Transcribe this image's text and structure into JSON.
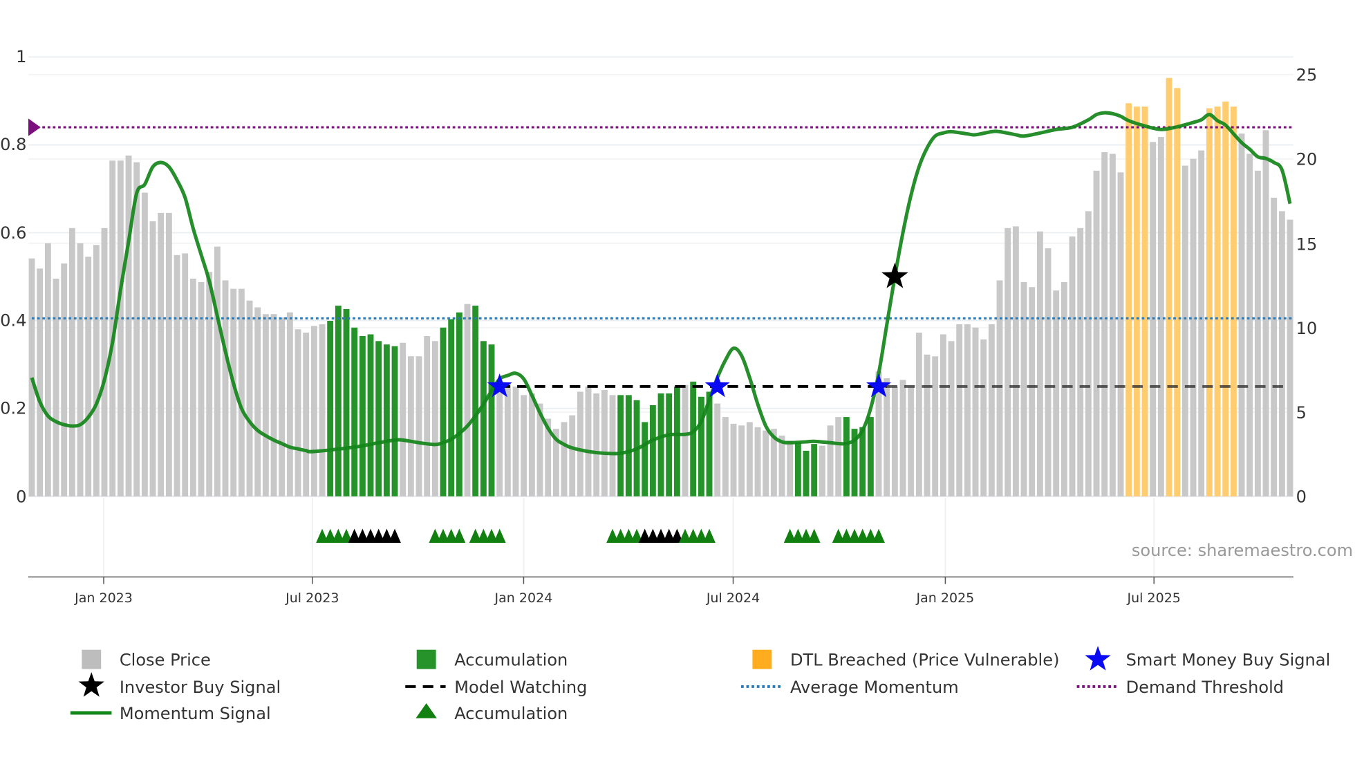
{
  "chart_data": {
    "type": "bar",
    "title": "",
    "source": "source: sharemaestro.com",
    "x_start_week": "2022-10-31",
    "x_interval": "weekly",
    "x_ticks": [
      "Jan 2023",
      "Jul 2023",
      "Jan 2024",
      "Jul 2024",
      "Jan 2025",
      "Jul 2025"
    ],
    "x_tick_week_index": [
      9,
      35,
      61,
      87,
      113,
      139
    ],
    "left_axis": {
      "ylim": [
        0,
        1
      ],
      "ticks": [
        "0",
        "0.2",
        "0.4",
        "0.6",
        "0.8",
        "1"
      ],
      "tick_values": [
        0,
        0.2,
        0.4,
        0.6,
        0.8,
        1
      ]
    },
    "right_axis": {
      "ylim": [
        0,
        25
      ],
      "ticks": [
        "0",
        "5",
        "10",
        "15",
        "20",
        "25"
      ],
      "tick_values": [
        0,
        5,
        10,
        15,
        20,
        25
      ]
    },
    "close_price": [
      14.1,
      13.5,
      15.0,
      12.9,
      13.8,
      15.9,
      15.0,
      14.2,
      14.9,
      15.9,
      19.9,
      19.9,
      20.2,
      19.8,
      18.0,
      16.3,
      16.8,
      16.8,
      14.3,
      14.4,
      12.9,
      12.7,
      13.3,
      14.8,
      12.8,
      12.3,
      12.3,
      11.6,
      11.2,
      10.8,
      10.8,
      10.6,
      10.9,
      9.9,
      9.7,
      10.1,
      10.2,
      10.4,
      11.3,
      11.1,
      10.0,
      9.5,
      9.6,
      9.2,
      9.0,
      8.9,
      9.1,
      8.3,
      8.3,
      9.5,
      9.2,
      10.0,
      10.5,
      10.9,
      11.4,
      11.3,
      9.2,
      9.0,
      6.9,
      6.7,
      6.5,
      6.0,
      6.1,
      5.5,
      4.6,
      4.0,
      4.4,
      4.8,
      6.2,
      6.5,
      6.1,
      6.3,
      6.0,
      6.0,
      6.0,
      5.7,
      4.4,
      5.4,
      6.1,
      6.1,
      6.5,
      6.6,
      6.8,
      5.9,
      6.2,
      5.5,
      4.7,
      4.3,
      4.2,
      4.4,
      4.1,
      3.9,
      4.0,
      3.6,
      3.3,
      3.2,
      2.7,
      3.1,
      3.0,
      4.2,
      4.7,
      4.7,
      4.0,
      4.1,
      4.7,
      7.4,
      7.0,
      6.5,
      6.9,
      6.5,
      9.7,
      8.4,
      8.3,
      9.6,
      9.2,
      10.2,
      10.2,
      10.0,
      9.3,
      10.2,
      12.8,
      15.9,
      16.0,
      12.7,
      12.4,
      15.7,
      14.7,
      12.2,
      12.7,
      15.4,
      15.9,
      16.9,
      19.3,
      20.4,
      20.3,
      19.2,
      23.3,
      23.1,
      23.1,
      21.0,
      21.3,
      24.8,
      24.2,
      19.6,
      20.0,
      20.5,
      23.0,
      23.1,
      23.4,
      23.1,
      21.5,
      20.3,
      19.3,
      21.7,
      17.7,
      16.9,
      16.4
    ],
    "bar_state": "ccccccccccccccccccccccccccccccccccccc",
    "accumulation_weeks": [
      37,
      38,
      39,
      40,
      41,
      42,
      43,
      44,
      45,
      51,
      52,
      53,
      55,
      56,
      57,
      73,
      74,
      75,
      76,
      77,
      78,
      79,
      80,
      82,
      83,
      84,
      95,
      96,
      97,
      101,
      102,
      103,
      104
    ],
    "dtl_breached_weeks": [
      136,
      137,
      138,
      141,
      142,
      146,
      147,
      148,
      149
    ],
    "momentum_signal": [
      [
        0,
        0.27
      ],
      [
        1,
        0.215
      ],
      [
        2,
        0.183
      ],
      [
        3,
        0.17
      ],
      [
        4,
        0.163
      ],
      [
        5,
        0.16
      ],
      [
        6,
        0.163
      ],
      [
        7,
        0.18
      ],
      [
        8,
        0.21
      ],
      [
        9,
        0.265
      ],
      [
        10,
        0.35
      ],
      [
        11,
        0.47
      ],
      [
        12,
        0.58
      ],
      [
        13,
        0.69
      ],
      [
        14,
        0.71
      ],
      [
        15,
        0.75
      ],
      [
        16,
        0.76
      ],
      [
        17,
        0.75
      ],
      [
        18,
        0.72
      ],
      [
        19,
        0.68
      ],
      [
        20,
        0.61
      ],
      [
        21,
        0.55
      ],
      [
        22,
        0.49
      ],
      [
        23,
        0.41
      ],
      [
        24,
        0.33
      ],
      [
        25,
        0.257
      ],
      [
        26,
        0.2
      ],
      [
        27,
        0.17
      ],
      [
        28,
        0.15
      ],
      [
        29,
        0.138
      ],
      [
        30,
        0.128
      ],
      [
        31,
        0.12
      ],
      [
        32,
        0.112
      ],
      [
        33,
        0.108
      ],
      [
        34,
        0.104
      ],
      [
        35,
        0.102
      ],
      [
        40,
        0.112
      ],
      [
        43,
        0.122
      ],
      [
        45,
        0.128
      ],
      [
        46,
        0.128
      ],
      [
        48,
        0.122
      ],
      [
        50,
        0.118
      ],
      [
        51,
        0.122
      ],
      [
        52,
        0.13
      ],
      [
        53,
        0.143
      ],
      [
        54,
        0.16
      ],
      [
        55,
        0.183
      ],
      [
        56,
        0.21
      ],
      [
        57,
        0.24
      ],
      [
        58,
        0.267
      ],
      [
        59,
        0.275
      ],
      [
        60,
        0.28
      ],
      [
        61,
        0.267
      ],
      [
        62,
        0.23
      ],
      [
        63,
        0.19
      ],
      [
        64,
        0.155
      ],
      [
        65,
        0.13
      ],
      [
        66,
        0.118
      ],
      [
        67,
        0.11
      ],
      [
        69,
        0.102
      ],
      [
        71,
        0.098
      ],
      [
        73,
        0.098
      ],
      [
        75,
        0.108
      ],
      [
        77,
        0.128
      ],
      [
        79,
        0.14
      ],
      [
        81,
        0.141
      ],
      [
        82,
        0.147
      ],
      [
        83,
        0.17
      ],
      [
        84,
        0.22
      ],
      [
        85,
        0.27
      ],
      [
        86,
        0.31
      ],
      [
        87,
        0.337
      ],
      [
        88,
        0.32
      ],
      [
        89,
        0.27
      ],
      [
        90,
        0.21
      ],
      [
        91,
        0.16
      ],
      [
        92,
        0.135
      ],
      [
        93,
        0.124
      ],
      [
        94,
        0.122
      ],
      [
        96,
        0.124
      ],
      [
        97,
        0.125
      ],
      [
        99,
        0.122
      ],
      [
        100,
        0.12
      ],
      [
        101,
        0.12
      ],
      [
        102,
        0.128
      ],
      [
        103,
        0.15
      ],
      [
        104,
        0.2
      ],
      [
        105,
        0.28
      ],
      [
        106,
        0.39
      ],
      [
        107,
        0.5
      ],
      [
        108,
        0.6
      ],
      [
        109,
        0.685
      ],
      [
        110,
        0.75
      ],
      [
        111,
        0.793
      ],
      [
        112,
        0.82
      ],
      [
        113,
        0.827
      ],
      [
        114,
        0.83
      ],
      [
        116,
        0.825
      ],
      [
        117,
        0.823
      ],
      [
        119,
        0.83
      ],
      [
        120,
        0.83
      ],
      [
        122,
        0.823
      ],
      [
        123,
        0.82
      ],
      [
        125,
        0.827
      ],
      [
        127,
        0.835
      ],
      [
        129,
        0.84
      ],
      [
        131,
        0.857
      ],
      [
        132,
        0.869
      ],
      [
        133,
        0.873
      ],
      [
        134,
        0.871
      ],
      [
        135,
        0.865
      ],
      [
        136,
        0.855
      ],
      [
        138,
        0.843
      ],
      [
        140,
        0.835
      ],
      [
        142,
        0.841
      ],
      [
        144,
        0.851
      ],
      [
        145,
        0.857
      ],
      [
        146,
        0.869
      ],
      [
        147,
        0.855
      ],
      [
        148,
        0.845
      ],
      [
        149,
        0.825
      ],
      [
        150,
        0.805
      ],
      [
        151,
        0.79
      ],
      [
        152,
        0.773
      ],
      [
        153,
        0.769
      ],
      [
        154,
        0.76
      ],
      [
        155,
        0.743
      ],
      [
        156,
        0.666
      ]
    ],
    "average_momentum": 0.405,
    "demand_threshold": 0.84,
    "model_watching": {
      "value": 0.25,
      "from_week": 58,
      "to_week": 156
    },
    "smart_money_buy_signals": [
      [
        58,
        0.25
      ],
      [
        85,
        0.25
      ],
      [
        105,
        0.25
      ]
    ],
    "investor_buy_signals": [
      [
        107,
        0.5
      ]
    ],
    "accumulation_markers": [
      {
        "week": 36,
        "kind": "green"
      },
      {
        "week": 37,
        "kind": "green"
      },
      {
        "week": 38,
        "kind": "green"
      },
      {
        "week": 39,
        "kind": "green"
      },
      {
        "week": 40,
        "kind": "black"
      },
      {
        "week": 41,
        "kind": "black"
      },
      {
        "week": 42,
        "kind": "black"
      },
      {
        "week": 43,
        "kind": "black"
      },
      {
        "week": 44,
        "kind": "black"
      },
      {
        "week": 45,
        "kind": "black"
      },
      {
        "week": 50,
        "kind": "green"
      },
      {
        "week": 51,
        "kind": "green"
      },
      {
        "week": 52,
        "kind": "green"
      },
      {
        "week": 53,
        "kind": "green"
      },
      {
        "week": 55,
        "kind": "green"
      },
      {
        "week": 56,
        "kind": "green"
      },
      {
        "week": 57,
        "kind": "green"
      },
      {
        "week": 58,
        "kind": "green"
      },
      {
        "week": 72,
        "kind": "green"
      },
      {
        "week": 73,
        "kind": "green"
      },
      {
        "week": 74,
        "kind": "green"
      },
      {
        "week": 75,
        "kind": "green"
      },
      {
        "week": 76,
        "kind": "black"
      },
      {
        "week": 77,
        "kind": "black"
      },
      {
        "week": 78,
        "kind": "black"
      },
      {
        "week": 79,
        "kind": "black"
      },
      {
        "week": 80,
        "kind": "black"
      },
      {
        "week": 81,
        "kind": "green"
      },
      {
        "week": 82,
        "kind": "green"
      },
      {
        "week": 83,
        "kind": "green"
      },
      {
        "week": 84,
        "kind": "green"
      },
      {
        "week": 94,
        "kind": "green"
      },
      {
        "week": 95,
        "kind": "green"
      },
      {
        "week": 96,
        "kind": "green"
      },
      {
        "week": 97,
        "kind": "green"
      },
      {
        "week": 100,
        "kind": "green"
      },
      {
        "week": 101,
        "kind": "green"
      },
      {
        "week": 102,
        "kind": "green"
      },
      {
        "week": 103,
        "kind": "green"
      },
      {
        "week": 104,
        "kind": "green"
      },
      {
        "week": 105,
        "kind": "green"
      }
    ],
    "legend": {
      "close_price": "Close Price",
      "accumulation_bar": "Accumulation",
      "dtl_breached": "DTL Breached (Price Vulnerable)",
      "smart_money": "Smart Money Buy Signal",
      "investor_buy": "Investor Buy Signal",
      "model_watching": "Model Watching",
      "average_momentum": "Average Momentum",
      "demand_threshold": "Demand Threshold",
      "momentum_signal": "Momentum Signal",
      "accumulation_marker": "Accumulation"
    },
    "legend_placement": "bottom",
    "grid": true
  },
  "colors": {
    "close": "#c8c8c8",
    "accumulation": "#25922a",
    "dtl": "#ffcc70",
    "dtl_legend": "#ffad1f",
    "momentum": "#13861a",
    "avg": "#2a7ab8",
    "threshold": "#7b0f7e",
    "smart": "#0a0af2",
    "investor": "#000000",
    "marker_green": "#118010",
    "marker_black": "#000000"
  }
}
